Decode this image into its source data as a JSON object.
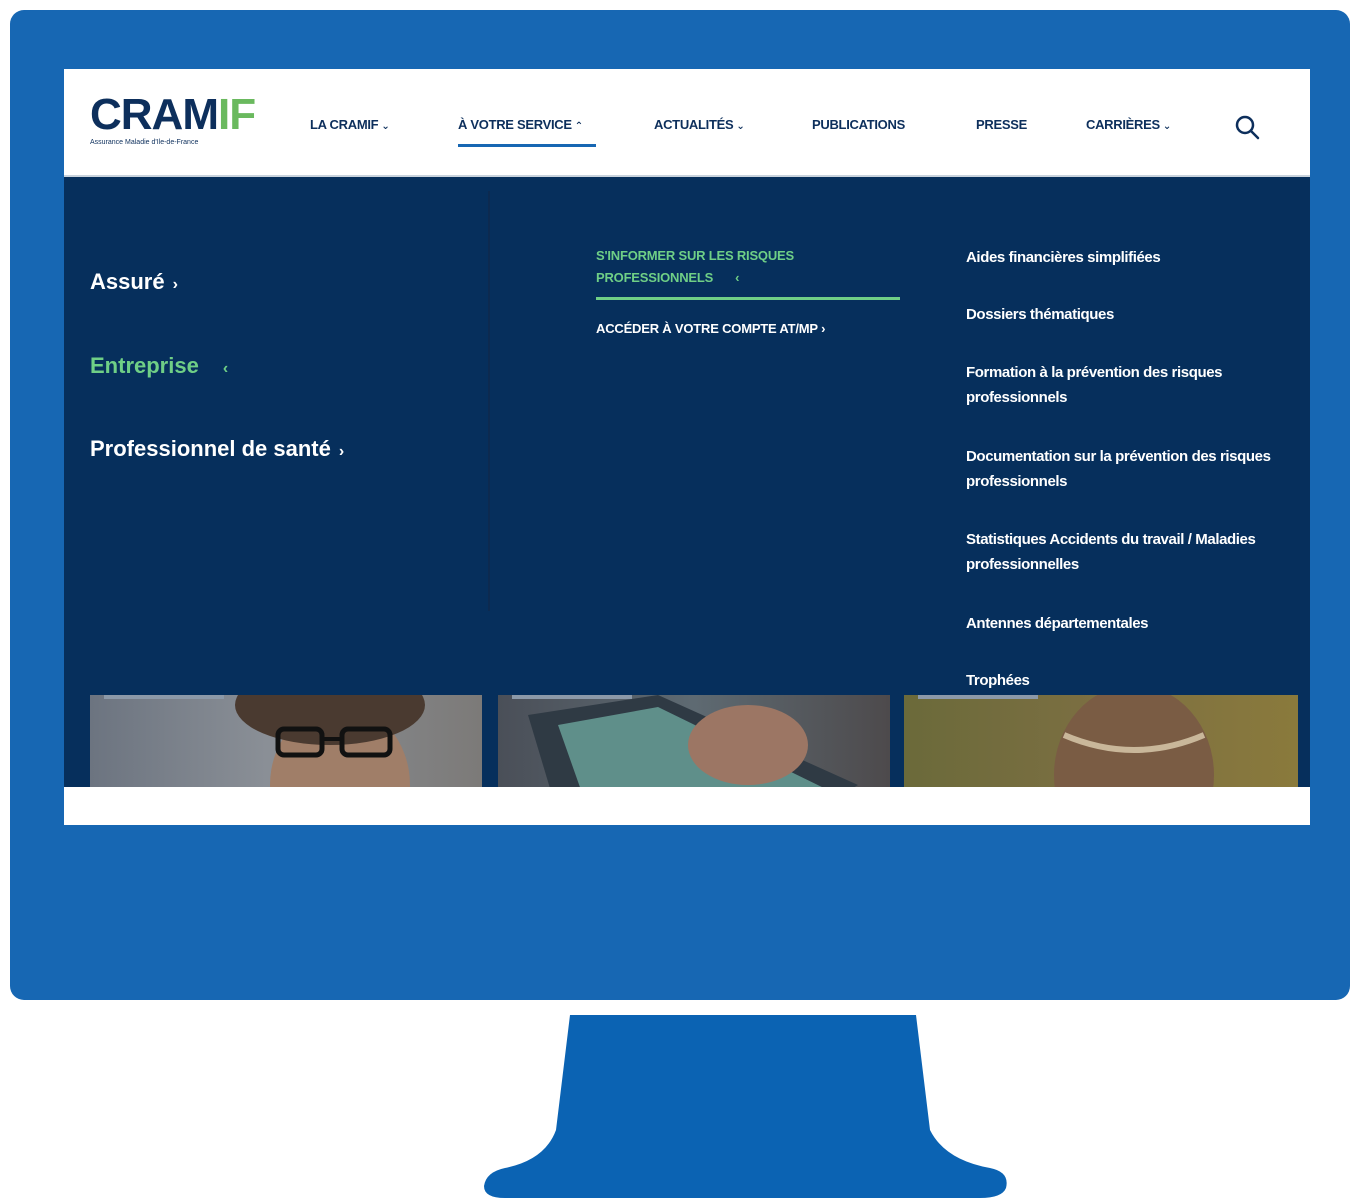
{
  "logo": {
    "part1": "CRAM",
    "part2": "IF",
    "tagline": "Assurance Maladie d'Ile-de-France"
  },
  "nav": [
    {
      "label": "LA CRAMIF",
      "chevron": "⌄"
    },
    {
      "label": "À VOTRE SERVICE",
      "chevron": "⌃"
    },
    {
      "label": "ACTUALITÉS",
      "chevron": "⌄"
    },
    {
      "label": "PUBLICATIONS",
      "chevron": ""
    },
    {
      "label": "PRESSE",
      "chevron": ""
    },
    {
      "label": "CARRIÈRES",
      "chevron": "⌄"
    }
  ],
  "menu": {
    "col1": [
      {
        "label": "Assuré",
        "arrow": "›"
      },
      {
        "label": "Entreprise",
        "arrow": "‹"
      },
      {
        "label": "Professionnel de santé",
        "arrow": "›"
      }
    ],
    "col2": {
      "title_line1": "S'INFORMER SUR LES RISQUES",
      "title_line2": "PROFESSIONNELS",
      "title_arrow": "‹",
      "link": "ACCÉDER À VOTRE COMPTE AT/MP ›"
    },
    "col3": [
      "Aides financières simplifiées",
      "Dossiers thématiques",
      "Formation à la prévention des risques professionnels",
      "Documentation sur la prévention des risques professionnels",
      "Statistiques Accidents du travail / Maladies professionnelles",
      "Antennes départementales",
      "Trophées"
    ]
  },
  "colors": {
    "frame": "#1767b3",
    "menu_bg": "#062f5c",
    "accent_green": "#6fcf86",
    "navy": "#0d2f5c"
  }
}
